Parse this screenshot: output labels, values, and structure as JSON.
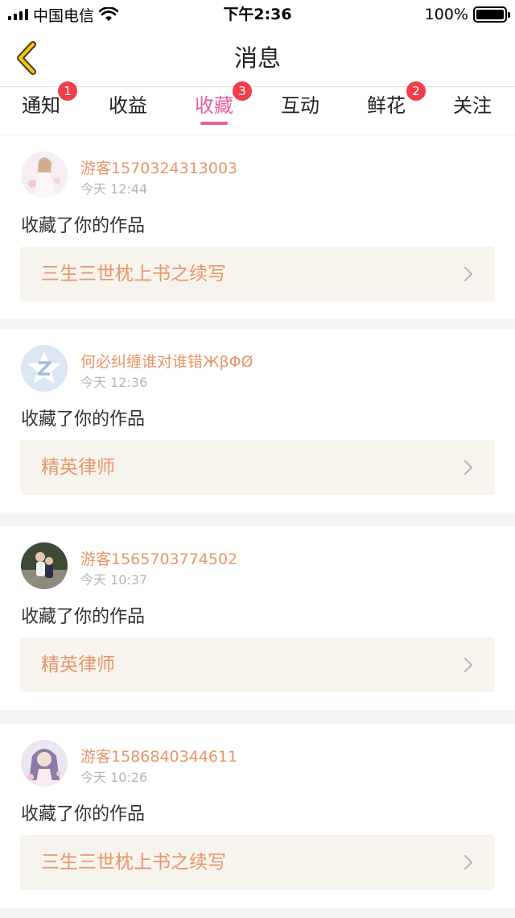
{
  "status_bar": {
    "carrier": "中国电信",
    "time": "下午2:36",
    "battery": "100%"
  },
  "navbar": {
    "back_icon": "chevron-left-icon",
    "title": "消息"
  },
  "tabs": [
    {
      "label": "通知",
      "badge": "1",
      "active": false
    },
    {
      "label": "收益",
      "badge": "",
      "active": false
    },
    {
      "label": "收藏",
      "badge": "3",
      "active": true
    },
    {
      "label": "互动",
      "badge": "",
      "active": false
    },
    {
      "label": "鲜花",
      "badge": "2",
      "active": false
    },
    {
      "label": "关注",
      "badge": "",
      "active": false
    }
  ],
  "colors": {
    "accent_pink": "#e7609c",
    "name_orange": "#e8956b",
    "badge_red": "#f33c4c",
    "work_bg": "#f6f4ed"
  },
  "messages": [
    {
      "username": "游客1570324313003",
      "time": "今天 12:44",
      "action": "收藏了你的作品",
      "work_title": "三生三世枕上书之续写"
    },
    {
      "username": "何必纠缠谁对谁错ЖβΦØ",
      "time": "今天 12:36",
      "action": "收藏了你的作品",
      "work_title": "精英律师"
    },
    {
      "username": "游客1565703774502",
      "time": "今天 10:37",
      "action": "收藏了你的作品",
      "work_title": "精英律师"
    },
    {
      "username": "游客1586840344611",
      "time": "今天 10:26",
      "action": "收藏了你的作品",
      "work_title": "三生三世枕上书之续写"
    }
  ]
}
